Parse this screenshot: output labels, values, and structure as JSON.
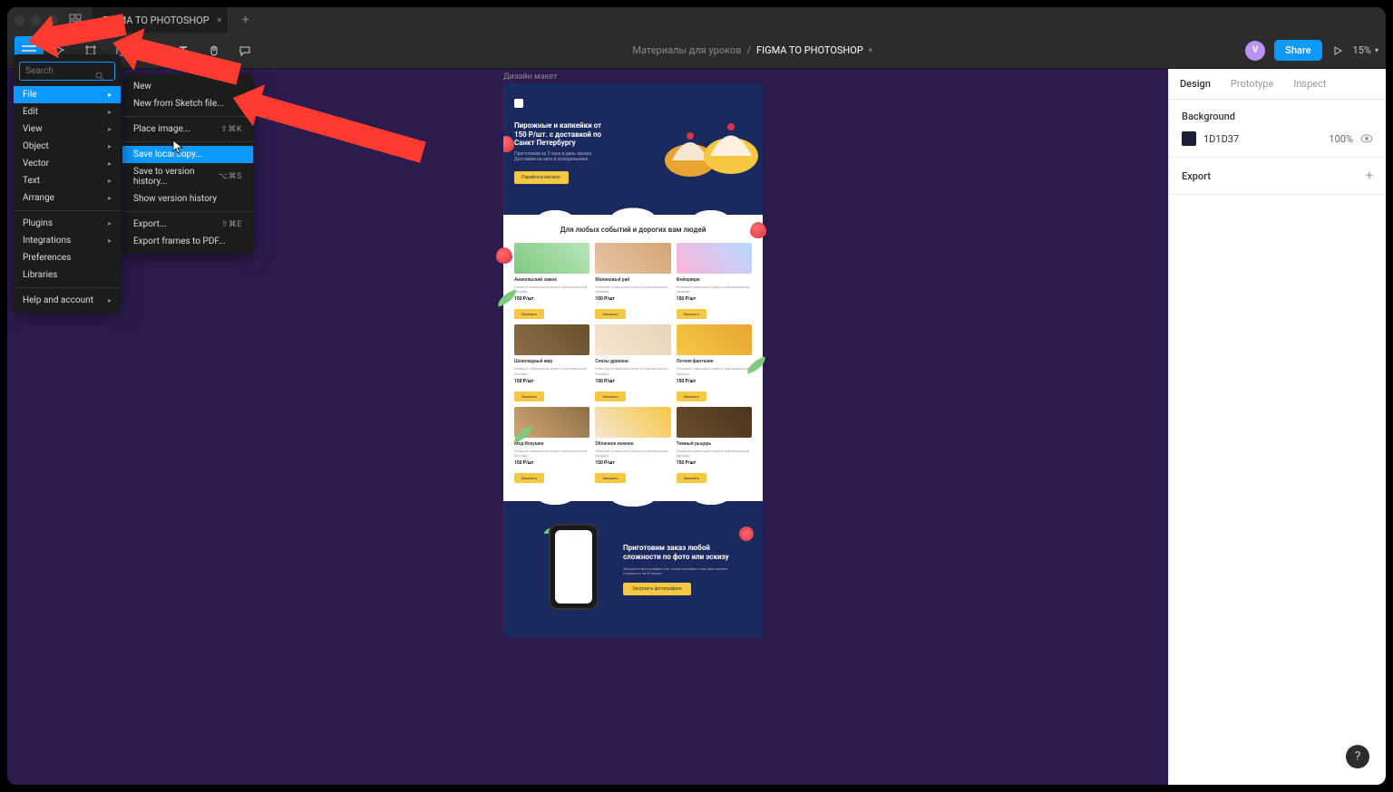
{
  "titlebar": {
    "tab_title": "FIGMA TO PHOTOSHOP"
  },
  "toolbar": {
    "breadcrumb_parent": "Материалы для уроков",
    "breadcrumb_current": "FIGMA TO PHOTOSHOP",
    "share_label": "Share",
    "zoom_label": "15%",
    "avatar_initial": "V"
  },
  "menu1": {
    "search_placeholder": "Search",
    "items": [
      "File",
      "Edit",
      "View",
      "Object",
      "Vector",
      "Text",
      "Arrange"
    ],
    "items2": [
      "Plugins",
      "Integrations",
      "Preferences",
      "Libraries"
    ],
    "items3": [
      "Help and account"
    ]
  },
  "menu2": {
    "new": "New",
    "new_sketch": "New from Sketch file...",
    "place_image": "Place image...",
    "place_image_sc": "⇧⌘K",
    "save_local": "Save local copy...",
    "save_version": "Save to version history...",
    "save_version_sc": "⌥⌘S",
    "show_history": "Show version history",
    "export": "Export...",
    "export_sc": "⇧⌘E",
    "export_pdf": "Export frames to PDF..."
  },
  "canvas": {
    "frame_label": "Дизайн макет"
  },
  "mockup": {
    "hero_title": "Пирожные и капкейки от 150 Р/шт. с доставкой по Санкт Петербургу",
    "hero_sub": "Приготовим за 3 часа в день заказа. Доставим на авто в холодильнике.",
    "hero_btn": "Перейти в каталог",
    "section1_title": "Для любых событий и дорогих вам людей",
    "cards": [
      {
        "name": "Анапольский замок",
        "price": "150 Р/шт",
        "btn": "Заказать"
      },
      {
        "name": "Малиновый рай",
        "price": "150 Р/шт",
        "btn": "Заказать"
      },
      {
        "name": "Фейерверк",
        "price": "150 Р/шт",
        "btn": "Заказать"
      },
      {
        "name": "Шоколадный мир",
        "price": "150 Р/шт",
        "btn": "Заказать"
      },
      {
        "name": "Слезы дракона",
        "price": "150 Р/шт",
        "btn": "Заказать"
      },
      {
        "name": "Летняя фантазия",
        "price": "150 Р/шт",
        "btn": "Заказать"
      },
      {
        "name": "Мед Искушен",
        "price": "150 Р/шт",
        "btn": "Заказать"
      },
      {
        "name": "Облачное нежное",
        "price": "150 Р/шт",
        "btn": "Заказать"
      },
      {
        "name": "Темный рыцарь",
        "price": "150 Р/шт",
        "btn": "Заказать"
      }
    ],
    "card_desc": "Нежный сливочный крем и оригинальный бисквит",
    "dark_title": "Приготовим заказ любой сложности по фото или эскизу",
    "dark_sub": "Загрузите фотографию или эскиз капкейка и мы рассчитаем стоимость за 30 минут",
    "dark_btn": "Загрузить фотографию"
  },
  "panel": {
    "tabs": [
      "Design",
      "Prototype",
      "Inspect"
    ],
    "bg_label": "Background",
    "bg_hex": "1D1D37",
    "bg_opacity": "100%",
    "export_label": "Export"
  }
}
